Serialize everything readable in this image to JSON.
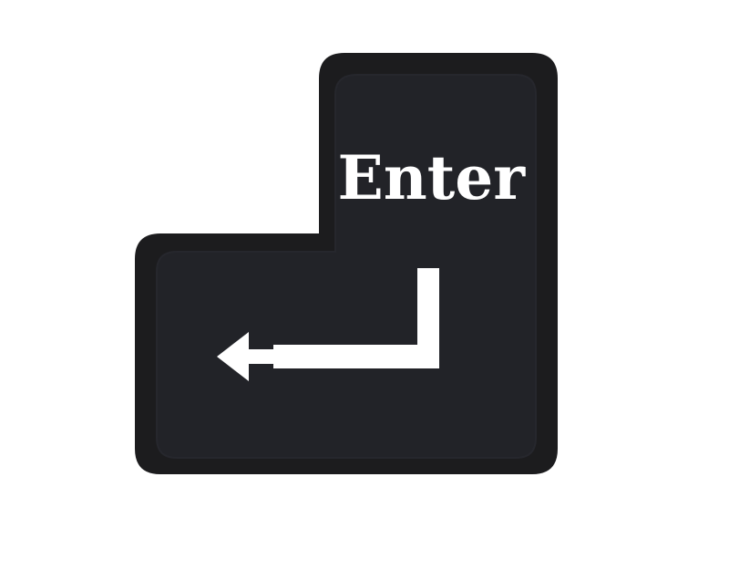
{
  "key": {
    "label": "Enter",
    "icon": "return-arrow-icon",
    "colors": {
      "outer": "#1c1c1e",
      "cap": "#222328",
      "cap_edge": "#26272d",
      "glyph": "#ffffff",
      "background": "#ffffff"
    }
  }
}
